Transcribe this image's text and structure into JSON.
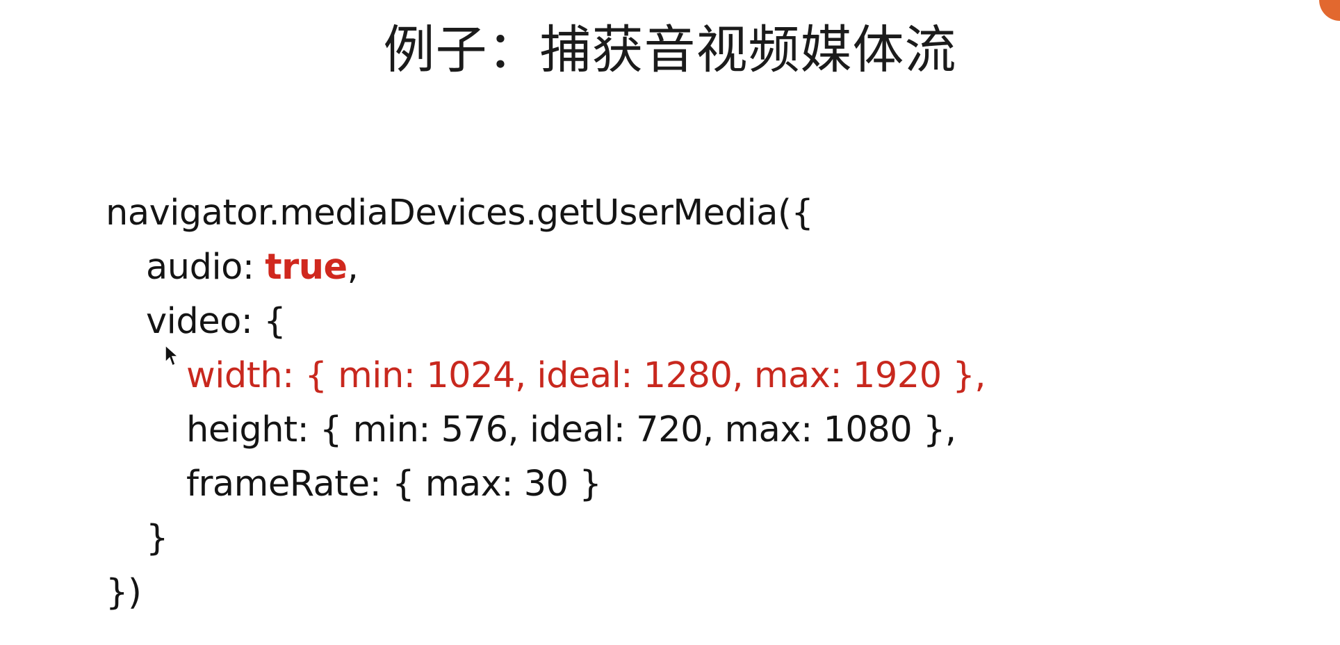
{
  "slide": {
    "title": "例子：捕获音视频媒体流",
    "code": {
      "line1": "navigator.mediaDevices.getUserMedia({",
      "audio_key": "audio: ",
      "audio_value": "true",
      "audio_tail": ",",
      "video_open": "video: {",
      "width_line": "width: { min: 1024, ideal: 1280, max: 1920 },",
      "height_line": "height: { min: 576, ideal: 720, max: 1080 },",
      "framerate_line": "frameRate: { max: 30 }",
      "video_close": "}",
      "end_line": "})"
    }
  },
  "colors": {
    "highlight": "#c8281e",
    "text": "#141414",
    "accent": "#e2682f"
  },
  "icons": {
    "cursor": "mouse-pointer-icon"
  }
}
